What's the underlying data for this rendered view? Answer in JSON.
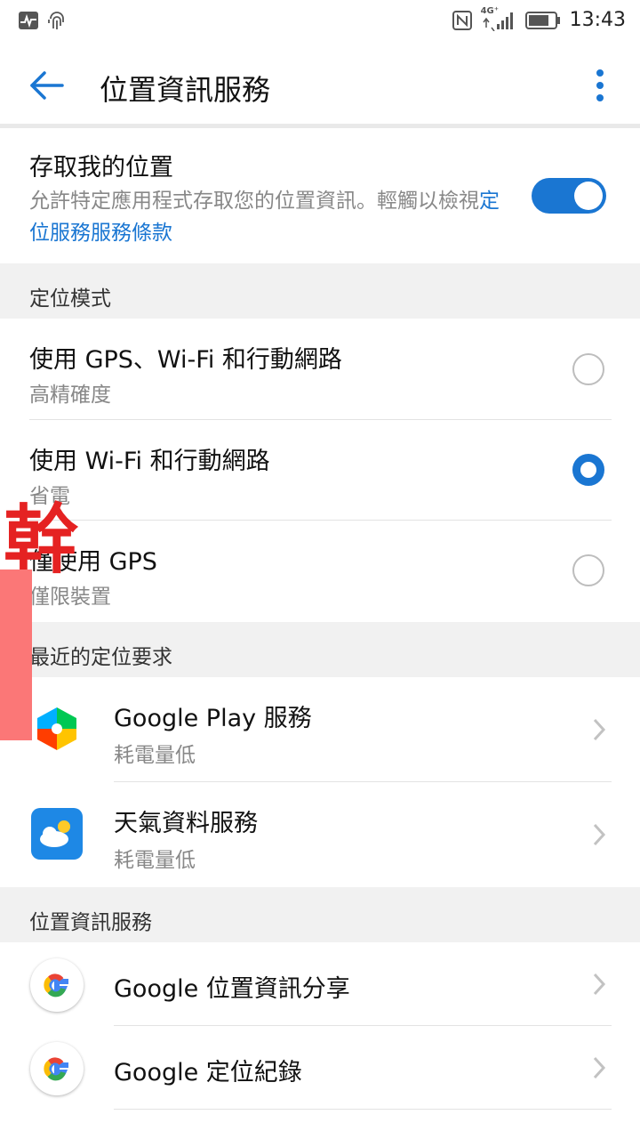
{
  "status_bar": {
    "time": "13:43",
    "left_icons": [
      "activity-icon",
      "fingerprint-icon"
    ],
    "right_icons": [
      "nfc-icon",
      "signal-4g-icon",
      "battery-icon"
    ],
    "network_label": "4G⁺"
  },
  "app_bar": {
    "title": "位置資訊服務",
    "back_icon": "arrow-left-icon",
    "more_icon": "more-vert-icon"
  },
  "access_location": {
    "title": "存取我的位置",
    "description": "允許特定應用程式存取您的位置資訊。輕觸以檢視",
    "link": "定位服務服務條款",
    "enabled": true
  },
  "location_mode": {
    "header": "定位模式",
    "options": [
      {
        "title": "使用 GPS、Wi-Fi 和行動網路",
        "subtitle": "高精確度",
        "selected": false
      },
      {
        "title": "使用 Wi-Fi 和行動網路",
        "subtitle": "省電",
        "selected": true
      },
      {
        "title": "僅使用 GPS",
        "subtitle": "僅限裝置",
        "selected": false
      }
    ]
  },
  "recent_requests": {
    "header": "最近的定位要求",
    "items": [
      {
        "title": "Google Play 服務",
        "subtitle": "耗電量低",
        "icon": "google-play-services-icon"
      },
      {
        "title": "天氣資料服務",
        "subtitle": "耗電量低",
        "icon": "weather-icon"
      }
    ]
  },
  "location_services": {
    "header": "位置資訊服務",
    "items": [
      {
        "title": "Google 位置資訊分享",
        "icon": "google-g-icon"
      },
      {
        "title": "Google 定位紀錄",
        "icon": "google-g-icon"
      }
    ]
  },
  "overlay": {
    "stamp_text": "幹",
    "stamp_color": "#e52222",
    "bar_color": "#fb7777"
  },
  "colors": {
    "accent": "#1a76d2",
    "secondary_text": "#888888",
    "section_bg": "#f1f1f1"
  }
}
